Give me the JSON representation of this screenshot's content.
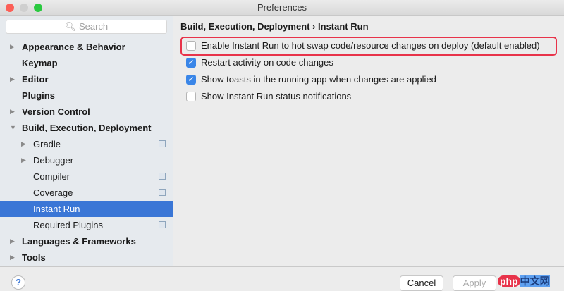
{
  "window": {
    "title": "Preferences"
  },
  "search": {
    "placeholder": "Search",
    "icon": "search-icon"
  },
  "tree": [
    {
      "label": "Appearance & Behavior",
      "level": 0,
      "expandable": true,
      "expanded": false,
      "bold": true
    },
    {
      "label": "Keymap",
      "level": 0,
      "expandable": false,
      "bold": true
    },
    {
      "label": "Editor",
      "level": 0,
      "expandable": true,
      "expanded": false,
      "bold": true
    },
    {
      "label": "Plugins",
      "level": 0,
      "expandable": false,
      "bold": true
    },
    {
      "label": "Version Control",
      "level": 0,
      "expandable": true,
      "expanded": false,
      "bold": true
    },
    {
      "label": "Build, Execution, Deployment",
      "level": 0,
      "expandable": true,
      "expanded": true,
      "bold": true
    },
    {
      "label": "Gradle",
      "level": 1,
      "expandable": true,
      "expanded": false,
      "project": true
    },
    {
      "label": "Debugger",
      "level": 1,
      "expandable": true,
      "expanded": false
    },
    {
      "label": "Compiler",
      "level": 1,
      "project": true
    },
    {
      "label": "Coverage",
      "level": 1,
      "project": true
    },
    {
      "label": "Instant Run",
      "level": 1,
      "selected": true
    },
    {
      "label": "Required Plugins",
      "level": 1,
      "project": true
    },
    {
      "label": "Languages & Frameworks",
      "level": 0,
      "expandable": true,
      "expanded": false,
      "bold": true
    },
    {
      "label": "Tools",
      "level": 0,
      "expandable": true,
      "expanded": false,
      "bold": true
    }
  ],
  "main": {
    "breadcrumb": "Build, Execution, Deployment › Instant Run",
    "options": [
      {
        "label": "Enable Instant Run to hot swap code/resource changes on deploy (default enabled)",
        "checked": false,
        "highlighted": true
      },
      {
        "label": "Restart activity on code changes",
        "checked": true
      },
      {
        "label": "Show toasts in the running app when changes are applied",
        "checked": true
      },
      {
        "label": "Show Instant Run status notifications",
        "checked": false
      }
    ]
  },
  "footer": {
    "help": "?",
    "cancel": "Cancel",
    "apply": "Apply",
    "watermark": "php中文网"
  },
  "colors": {
    "selection": "#3a76d6",
    "highlight": "#e8334a",
    "checkbox": "#3a86e8"
  }
}
